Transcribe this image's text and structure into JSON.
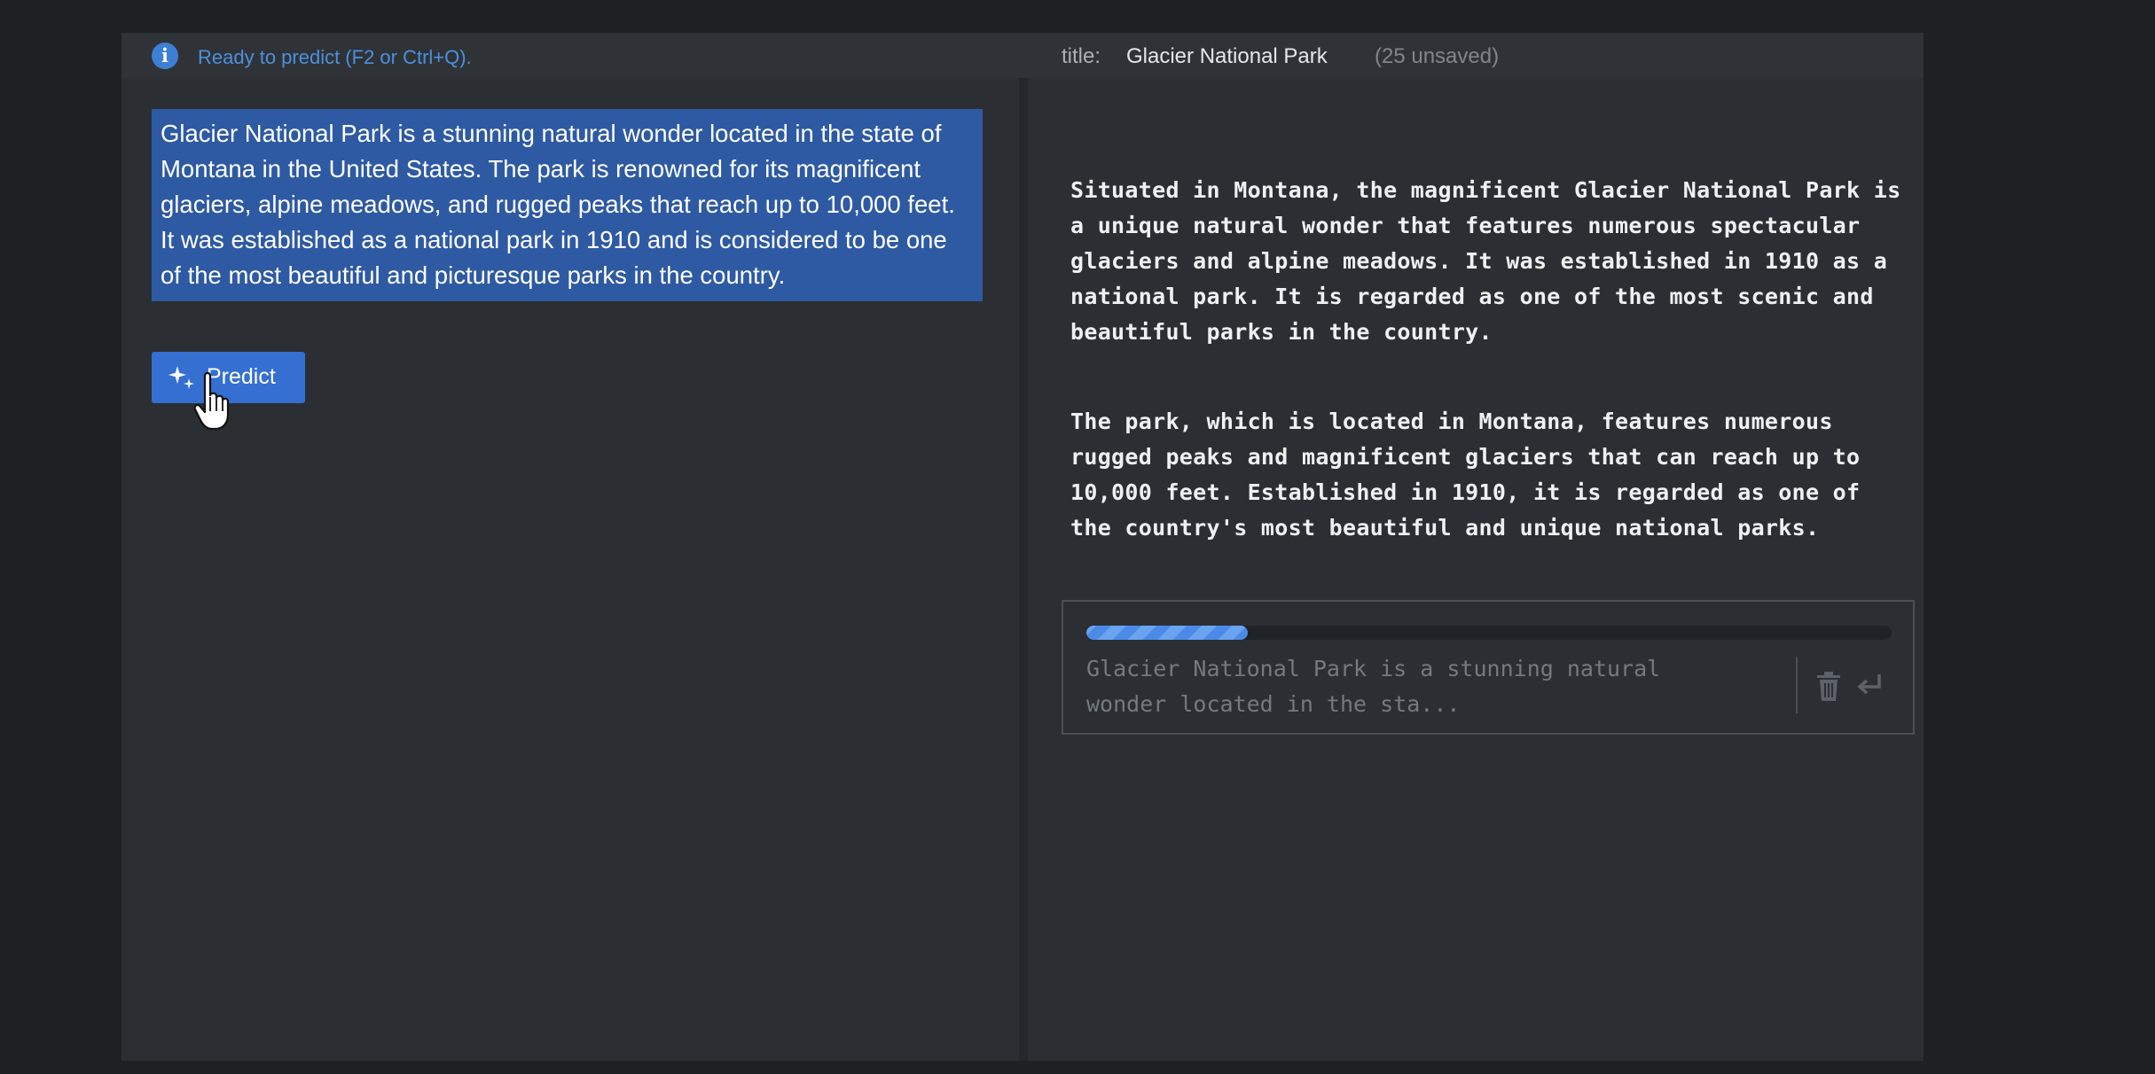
{
  "status": {
    "text": "Ready to predict (F2 or Ctrl+Q)."
  },
  "document": {
    "title_label": "title:",
    "title": "Glacier National Park",
    "unsaved": "(25 unsaved)"
  },
  "editor": {
    "source_text": "Glacier National Park is a stunning natural wonder located in the state of Montana in the United States. The park is renowned for its magnificent glaciers, alpine meadows, and rugged peaks that reach up to 10,000 feet. It was established as a national park in 1910 and is considered to be one of the most beautiful and picturesque parks in the country."
  },
  "toolbar": {
    "predict_label": "Predict"
  },
  "outputs": [
    "Situated in Montana, the magnificent Glacier National Park is a unique natural wonder that features numerous spectacular glaciers and alpine meadows. It was established in 1910 as a national park. It is regarded as one of the most scenic and beautiful parks in the country.",
    "The park, which is located in Montana, features numerous rugged peaks and magnificent glaciers that can reach up to 10,000 feet. Established in 1910, it is regarded as one of the country's most beautiful and unique national parks."
  ],
  "pending": {
    "progress_percent": 20,
    "preview_text": "Glacier National Park is a stunning natural wonder located in the sta..."
  },
  "icons": {
    "info": "info-icon",
    "predict": "sparkle-icon",
    "cursor": "hand-pointer-icon",
    "delete": "trash-icon",
    "submit": "enter-icon"
  },
  "colors": {
    "accent": "#356fd1",
    "selection": "#2e5aa3",
    "status_text": "#4d8fde"
  }
}
